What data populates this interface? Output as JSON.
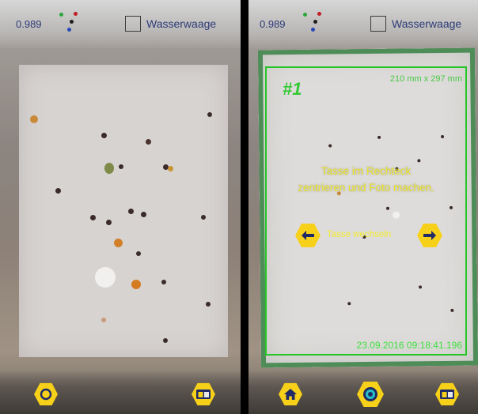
{
  "left": {
    "reading": "0.989",
    "level_label": "Wasserwaage",
    "level_checked": false,
    "bottom_buttons": [
      "target-icon",
      "tasse-card-icon"
    ]
  },
  "right": {
    "reading": "0.989",
    "level_label": "Wasserwaage",
    "level_checked": false,
    "frame": {
      "marker": "#1",
      "dimensions": "210 mm x 297 mm",
      "instruction_line1": "Tasse im Rechteck",
      "instruction_line2": "zentrieren und Foto machen.",
      "switch_label": "Tasse wechseln",
      "timestamp": "23.09.2016 09:18:41.196"
    },
    "bottom_buttons": [
      "home-icon",
      "shutter-icon",
      "tasse-card-icon"
    ]
  },
  "colors": {
    "accent_yellow": "#f7d01a",
    "frame_green": "#26c626",
    "label_blue": "#2d3b78"
  }
}
